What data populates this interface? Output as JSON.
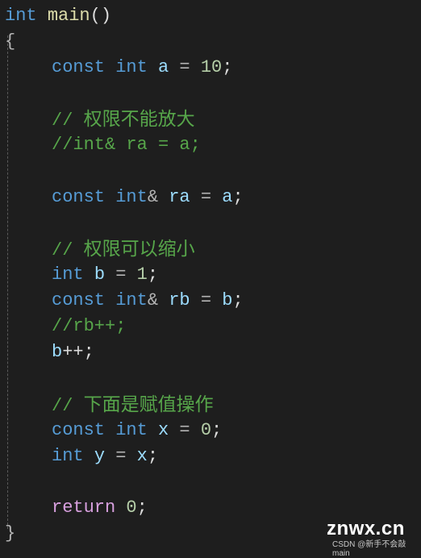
{
  "editor": {
    "lines": [
      {
        "tokens": [
          {
            "t": "int",
            "c": "kw"
          },
          {
            "t": " "
          },
          {
            "t": "main",
            "c": "fn"
          },
          {
            "t": "()",
            "c": "punc"
          }
        ]
      },
      {
        "tokens": [
          {
            "t": "{",
            "c": "brace"
          }
        ]
      },
      {
        "tokens": [
          {
            "t": "const",
            "c": "kw"
          },
          {
            "t": " "
          },
          {
            "t": "int",
            "c": "kw"
          },
          {
            "t": " "
          },
          {
            "t": "a",
            "c": "var"
          },
          {
            "t": " = ",
            "c": "op"
          },
          {
            "t": "10",
            "c": "num"
          },
          {
            "t": ";",
            "c": "punc"
          }
        ]
      },
      {
        "tokens": [
          {
            "t": "// ",
            "c": "cmt"
          },
          {
            "t": "权限不能放大",
            "c": "cmt-cn"
          }
        ]
      },
      {
        "tokens": [
          {
            "t": "//int& ra = a;",
            "c": "cmt"
          }
        ]
      },
      {
        "tokens": [
          {
            "t": "const",
            "c": "kw"
          },
          {
            "t": " "
          },
          {
            "t": "int",
            "c": "kw"
          },
          {
            "t": "& ",
            "c": "op"
          },
          {
            "t": "ra",
            "c": "var"
          },
          {
            "t": " = ",
            "c": "op"
          },
          {
            "t": "a",
            "c": "var"
          },
          {
            "t": ";",
            "c": "punc"
          }
        ]
      },
      {
        "tokens": [
          {
            "t": "// ",
            "c": "cmt"
          },
          {
            "t": "权限可以缩小",
            "c": "cmt-cn"
          }
        ]
      },
      {
        "tokens": [
          {
            "t": "int",
            "c": "kw"
          },
          {
            "t": " "
          },
          {
            "t": "b",
            "c": "var"
          },
          {
            "t": " = ",
            "c": "op"
          },
          {
            "t": "1",
            "c": "num"
          },
          {
            "t": ";",
            "c": "punc"
          }
        ]
      },
      {
        "tokens": [
          {
            "t": "const",
            "c": "kw"
          },
          {
            "t": " "
          },
          {
            "t": "int",
            "c": "kw"
          },
          {
            "t": "& ",
            "c": "op"
          },
          {
            "t": "rb",
            "c": "var"
          },
          {
            "t": " = ",
            "c": "op"
          },
          {
            "t": "b",
            "c": "var"
          },
          {
            "t": ";",
            "c": "punc"
          }
        ]
      },
      {
        "tokens": [
          {
            "t": "//rb++;",
            "c": "cmt"
          }
        ]
      },
      {
        "tokens": [
          {
            "t": "b",
            "c": "var"
          },
          {
            "t": "++;",
            "c": "punc"
          }
        ]
      },
      {
        "tokens": [
          {
            "t": "// ",
            "c": "cmt"
          },
          {
            "t": "下面是赋值操作",
            "c": "cmt-cn"
          }
        ]
      },
      {
        "tokens": [
          {
            "t": "const",
            "c": "kw"
          },
          {
            "t": " "
          },
          {
            "t": "int",
            "c": "kw"
          },
          {
            "t": " "
          },
          {
            "t": "x",
            "c": "var"
          },
          {
            "t": " = ",
            "c": "op"
          },
          {
            "t": "0",
            "c": "num"
          },
          {
            "t": ";",
            "c": "punc"
          }
        ]
      },
      {
        "tokens": [
          {
            "t": "int",
            "c": "kw"
          },
          {
            "t": " "
          },
          {
            "t": "y",
            "c": "var"
          },
          {
            "t": " = ",
            "c": "op"
          },
          {
            "t": "x",
            "c": "var"
          },
          {
            "t": ";",
            "c": "punc"
          }
        ]
      },
      {
        "tokens": [
          {
            "t": "return",
            "c": "ret"
          },
          {
            "t": " "
          },
          {
            "t": "0",
            "c": "num"
          },
          {
            "t": ";",
            "c": "punc"
          }
        ]
      },
      {
        "tokens": [
          {
            "t": "}",
            "c": "brace"
          }
        ]
      }
    ]
  },
  "watermark": {
    "site": "znwx.cn",
    "credit": "CSDN @新手不会敲main"
  }
}
